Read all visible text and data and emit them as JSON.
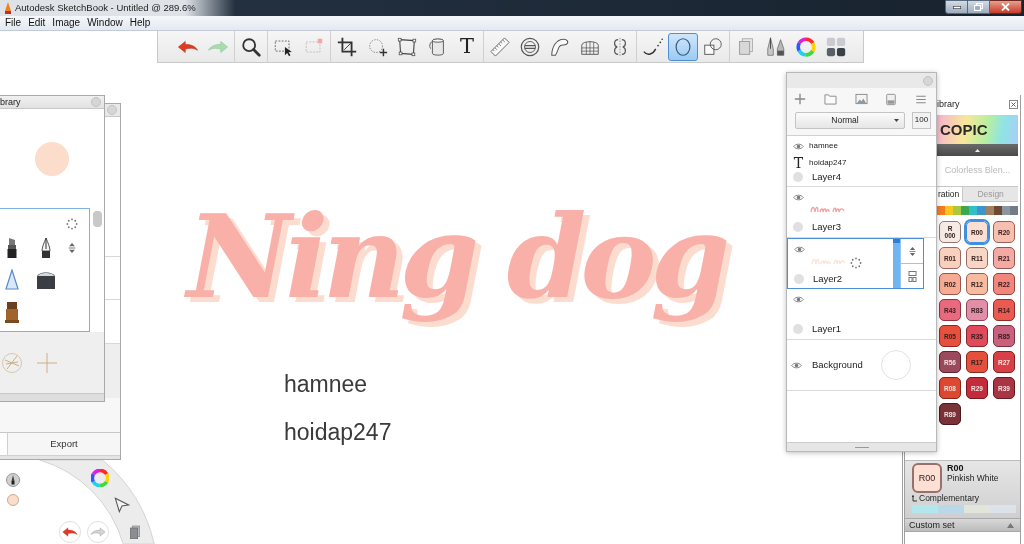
{
  "window": {
    "title": "Autodesk SketchBook - Untitled @ 289.6%"
  },
  "menu": [
    "File",
    "Edit",
    "Image",
    "Window",
    "Help"
  ],
  "toolbar": {
    "groups": [
      {
        "tools": [
          {
            "kind": "undo",
            "selected": false
          },
          {
            "kind": "redo",
            "selected": false
          }
        ]
      },
      {
        "tools": [
          {
            "kind": "zoom",
            "selected": false
          }
        ]
      },
      {
        "tools": [
          {
            "kind": "select",
            "selected": false
          },
          {
            "kind": "deselect",
            "selected": false
          }
        ]
      },
      {
        "tools": [
          {
            "kind": "crop",
            "selected": false
          },
          {
            "kind": "transform",
            "selected": false
          },
          {
            "kind": "distort",
            "selected": false
          },
          {
            "kind": "fill",
            "selected": false
          },
          {
            "kind": "text",
            "glyph": "T",
            "selected": false
          }
        ]
      },
      {
        "tools": [
          {
            "kind": "ruler",
            "selected": false
          },
          {
            "kind": "ellipse",
            "selected": false
          },
          {
            "kind": "curve",
            "selected": false
          },
          {
            "kind": "perspective",
            "selected": false
          },
          {
            "kind": "symmetry",
            "selected": false
          }
        ]
      },
      {
        "tools": [
          {
            "kind": "stroke",
            "selected": false
          },
          {
            "kind": "circle",
            "selected": true
          },
          {
            "kind": "shape",
            "selected": false
          }
        ]
      },
      {
        "tools": [
          {
            "kind": "copy",
            "selected": false
          },
          {
            "kind": "brushes",
            "selected": false
          },
          {
            "kind": "colors",
            "selected": false
          },
          {
            "kind": "library",
            "selected": false
          }
        ]
      }
    ]
  },
  "brush_panel": {
    "title": "brary",
    "loading": true,
    "brushes": [
      {
        "kind": "marker"
      },
      {
        "kind": "pen"
      },
      {
        "kind": "airbrush"
      },
      {
        "kind": "block"
      },
      {
        "kind": "stamp"
      }
    ],
    "special_brushes": [
      {
        "kind": "rune"
      },
      {
        "kind": "sparkle"
      }
    ],
    "footer": [
      "Export"
    ]
  },
  "canvas": {
    "lettering": "Ning dog",
    "texts": [
      "hamnee",
      "hoidap247"
    ]
  },
  "layers_panel": {
    "blend_mode": "Normal",
    "opacity": "100",
    "layers": [
      {
        "kind": "text",
        "name": "Layer4",
        "selected": false,
        "items": [
          {
            "kind": "visible",
            "label": "hamnee"
          },
          {
            "kind": "type",
            "glyph": "T",
            "label": "hoidap247"
          }
        ]
      },
      {
        "kind": "paint",
        "name": "Layer3",
        "selected": false,
        "thumbnail": true,
        "faint": false
      },
      {
        "kind": "paint",
        "name": "Layer2",
        "selected": true,
        "thumbnail": true,
        "faint": true,
        "loading": true,
        "level": 1
      },
      {
        "kind": "paint",
        "name": "Layer1",
        "selected": false
      },
      {
        "kind": "background",
        "name": "Background",
        "selected": false
      }
    ]
  },
  "color_library": {
    "title": "ibrary",
    "brand": "COPIC",
    "blender": {
      "label": "Colorless Blen...",
      "disabled": true
    },
    "tabs": [
      {
        "label": "ration",
        "selected": true
      },
      {
        "label": "Design",
        "selected": false
      }
    ],
    "families": [
      {
        "color": "#f47b20"
      },
      {
        "color": "#f9c51f"
      },
      {
        "color": "#a7c83f"
      },
      {
        "color": "#3fa651"
      },
      {
        "color": "#32bfc4"
      },
      {
        "color": "#3f93cf"
      },
      {
        "color": "#a38061"
      },
      {
        "color": "#6e4a33"
      },
      {
        "color": "#8b96a3"
      },
      {
        "color": "#737b86"
      }
    ],
    "swatches": [
      {
        "label": "R 000",
        "color": "#f5ebe4",
        "selected": false
      },
      {
        "label": "R00",
        "color": "#fbe0d3",
        "selected": true
      },
      {
        "label": "R20",
        "color": "#f7bfae",
        "selected": false
      },
      {
        "label": "R01",
        "color": "#f8d0bd",
        "selected": false
      },
      {
        "label": "R11",
        "color": "#f8d6c6",
        "selected": false
      },
      {
        "label": "R21",
        "color": "#f4aaa3",
        "selected": false
      },
      {
        "label": "R02",
        "color": "#f6ab92",
        "selected": false
      },
      {
        "label": "R12",
        "color": "#f7bc9f",
        "selected": false
      },
      {
        "label": "R22",
        "color": "#f2867c",
        "selected": false
      },
      {
        "label": "R43",
        "color": "#e96a7e",
        "selected": false
      },
      {
        "label": "R83",
        "color": "#e38ea8",
        "selected": false
      },
      {
        "label": "R14",
        "color": "#ea5a50",
        "selected": false
      },
      {
        "label": "R05",
        "color": "#e8503e",
        "selected": false
      },
      {
        "label": "R35",
        "color": "#e04a5a",
        "selected": false
      },
      {
        "label": "R85",
        "color": "#c8607e",
        "selected": false
      },
      {
        "label": "R56",
        "color": "#9a4a5c",
        "selected": false
      },
      {
        "label": "R17",
        "color": "#e4503c",
        "selected": false
      },
      {
        "label": "R27",
        "color": "#d84048",
        "selected": false
      },
      {
        "label": "R08",
        "color": "#dc4830",
        "selected": false
      },
      {
        "label": "R29",
        "color": "#c42c3c",
        "selected": false
      },
      {
        "label": "R39",
        "color": "#a83444",
        "selected": false
      },
      {
        "label": "R89",
        "color": "#783238",
        "selected": false
      }
    ],
    "current": {
      "swatch": "R00",
      "code": "R00",
      "name": "Pinkish White",
      "color": "#fbe0d3"
    },
    "complementary": {
      "label": "Complementary",
      "colors": [
        {
          "color": "#b4e6ee"
        },
        {
          "color": "#b9d9ea"
        },
        {
          "color": "#e2e6da"
        },
        {
          "color": "#dbe2ea"
        }
      ]
    },
    "custom_set": "Custom set"
  }
}
